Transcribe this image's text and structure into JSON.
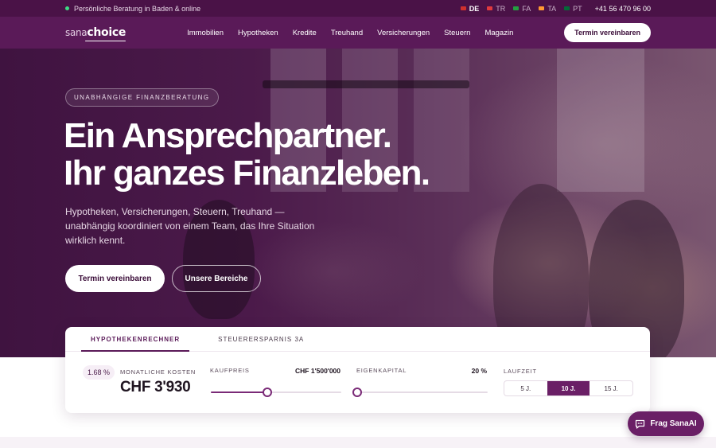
{
  "topbar": {
    "tagline": "Persönliche Beratung in Baden & online",
    "languages": [
      {
        "code": "DE",
        "active": true,
        "flag_color": "#d0312d"
      },
      {
        "code": "TR",
        "active": false,
        "flag_color": "#e03a3e"
      },
      {
        "code": "FA",
        "active": false,
        "flag_color": "#239f40"
      },
      {
        "code": "TA",
        "active": false,
        "flag_color": "#ff9933"
      },
      {
        "code": "PT",
        "active": false,
        "flag_color": "#046a38"
      }
    ],
    "phone": "+41 56 470 96 00"
  },
  "nav": {
    "logo_part1": "sana",
    "logo_part2": "choice",
    "items": [
      "Immobilien",
      "Hypotheken",
      "Kredite",
      "Treuhand",
      "Versicherungen",
      "Steuern",
      "Magazin"
    ],
    "cta": "Termin vereinbaren"
  },
  "hero": {
    "badge": "UNABHÄNGIGE FINANZBERATUNG",
    "headline_line1": "Ein Ansprechpartner.",
    "headline_line2": "Ihr ganzes Finanzleben.",
    "subtitle": "Hypotheken, Versicherungen, Steuern, Treuhand — unabhängig koordiniert von einem Team, das Ihre Situation wirklich kennt.",
    "primary_button": "Termin vereinbaren",
    "secondary_button": "Unsere Bereiche"
  },
  "calculator": {
    "tabs": [
      "HYPOTHEKENRECHNER",
      "STEUERERSPARNIS 3A"
    ],
    "active_tab": 0,
    "rate": "1.68 %",
    "monthly_label": "MONATLICHE KOSTEN",
    "monthly_value": "CHF 3'930",
    "price_label": "KAUFPREIS",
    "price_value": "CHF 1'500'000",
    "price_slider_level": 0.43,
    "equity_label": "EIGENKAPITAL",
    "equity_value": "20 %",
    "equity_slider_level": 0.0,
    "term_label": "LAUFZEIT",
    "terms": [
      "5 J.",
      "10 J.",
      "15 J."
    ],
    "selected_term": 1
  },
  "chat": {
    "label": "Frag SanaAI"
  },
  "colors": {
    "brand": "#5a1a58",
    "brand_dark": "#4a1247",
    "accent": "#7a2a77"
  }
}
